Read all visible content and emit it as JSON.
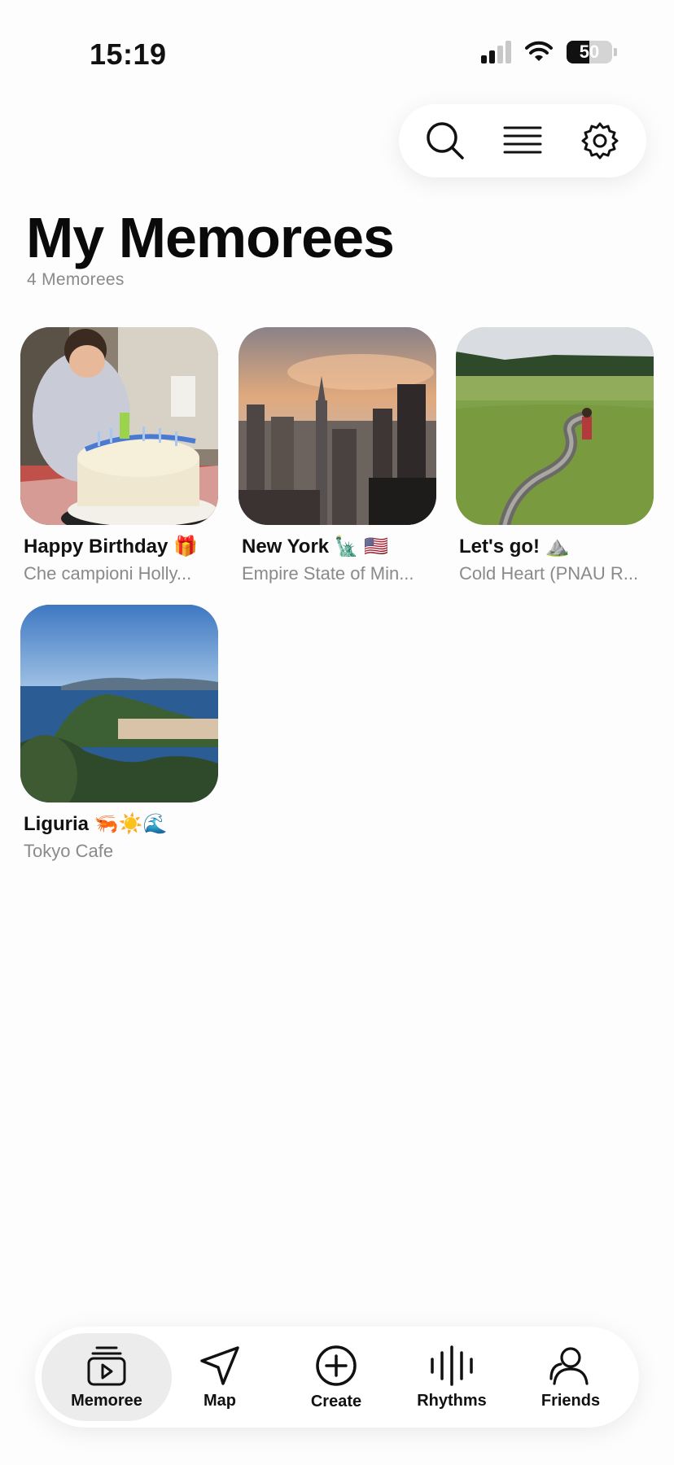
{
  "status_bar": {
    "time": "15:19",
    "battery": "50",
    "battery_level": 0.5
  },
  "toolbar": {
    "icons": [
      "search-icon",
      "list-icon",
      "settings-gear-icon"
    ]
  },
  "header": {
    "title": "My Memorees",
    "count": "4 Memorees"
  },
  "memorees": [
    {
      "title": "Happy Birthday 🎁",
      "subtitle": "Che campioni Holly..."
    },
    {
      "title": "New York 🗽 🇺🇸",
      "subtitle": "Empire State of Min..."
    },
    {
      "title": "Let's go! ⛰️",
      "subtitle": "Cold Heart (PNAU R..."
    },
    {
      "title": "Liguria 🦐☀️🌊",
      "subtitle": "Tokyo Cafe"
    }
  ],
  "tab_bar": {
    "tabs": [
      {
        "label": "Memoree",
        "icon": "memoree-icon",
        "active": true
      },
      {
        "label": "Map",
        "icon": "map-arrow-icon",
        "active": false
      },
      {
        "label": "Create",
        "icon": "create-plus-icon",
        "active": false
      },
      {
        "label": "Rhythms",
        "icon": "rhythms-waveform-icon",
        "active": false
      },
      {
        "label": "Friends",
        "icon": "friends-icon",
        "active": false
      }
    ]
  },
  "colors": {
    "background": "#fdfdfd",
    "text": "#111111",
    "secondary_text": "#8a8a8a",
    "active_tab": "#ececec"
  }
}
